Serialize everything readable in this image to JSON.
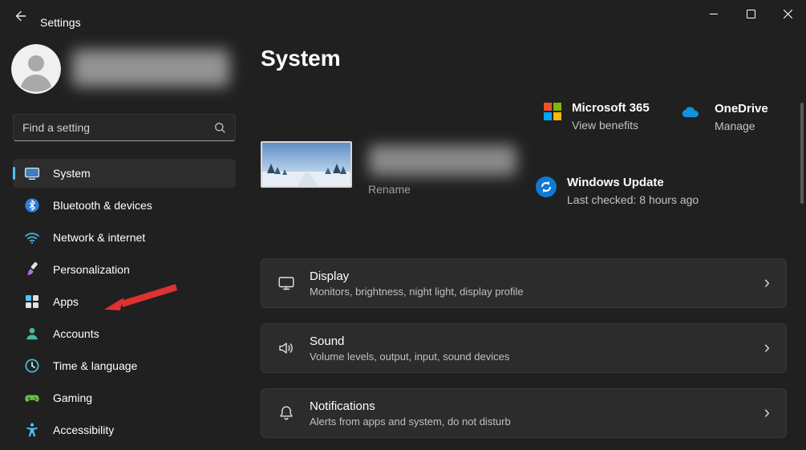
{
  "titlebar": {
    "title": "Settings"
  },
  "sidebar": {
    "search": {
      "placeholder": "Find a setting"
    },
    "items": [
      {
        "label": "System",
        "selected": true
      },
      {
        "label": "Bluetooth & devices",
        "selected": false
      },
      {
        "label": "Network & internet",
        "selected": false
      },
      {
        "label": "Personalization",
        "selected": false
      },
      {
        "label": "Apps",
        "selected": false
      },
      {
        "label": "Accounts",
        "selected": false
      },
      {
        "label": "Time & language",
        "selected": false
      },
      {
        "label": "Gaming",
        "selected": false
      },
      {
        "label": "Accessibility",
        "selected": false
      }
    ]
  },
  "main": {
    "title": "System",
    "device": {
      "rename_label": "Rename"
    },
    "promos": {
      "microsoft365": {
        "title": "Microsoft 365",
        "action": "View benefits"
      },
      "onedrive": {
        "title": "OneDrive",
        "action": "Manage"
      },
      "windows_update": {
        "title": "Windows Update",
        "status": "Last checked: 8 hours ago"
      }
    },
    "cards": [
      {
        "title": "Display",
        "subtitle": "Monitors, brightness, night light, display profile"
      },
      {
        "title": "Sound",
        "subtitle": "Volume levels, output, input, sound devices"
      },
      {
        "title": "Notifications",
        "subtitle": "Alerts from apps and system, do not disturb"
      }
    ]
  },
  "icons": {
    "chevron": "›"
  },
  "colors": {
    "accent": "#4cc2ff",
    "background": "#202020",
    "card": "#2c2c2c",
    "annotation": "#e03131"
  }
}
